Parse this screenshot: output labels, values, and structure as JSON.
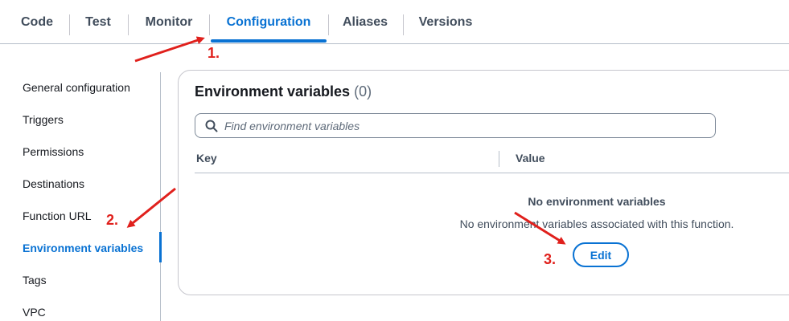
{
  "tabs": [
    {
      "label": "Code"
    },
    {
      "label": "Test"
    },
    {
      "label": "Monitor"
    },
    {
      "label": "Configuration"
    },
    {
      "label": "Aliases"
    },
    {
      "label": "Versions"
    }
  ],
  "active_tab": "Configuration",
  "sidebar": {
    "items": [
      {
        "label": "General configuration"
      },
      {
        "label": "Triggers"
      },
      {
        "label": "Permissions"
      },
      {
        "label": "Destinations"
      },
      {
        "label": "Function URL"
      },
      {
        "label": "Environment variables"
      },
      {
        "label": "Tags"
      },
      {
        "label": "VPC"
      }
    ],
    "active": "Environment variables"
  },
  "panel": {
    "title": "Environment variables",
    "count": "(0)",
    "search": {
      "placeholder": "Find environment variables",
      "value": ""
    },
    "columns": [
      "Key",
      "Value"
    ],
    "empty_title": "No environment variables",
    "empty_desc": "No environment variables associated with this function.",
    "edit_label": "Edit"
  },
  "annotations": {
    "step1": "1.",
    "step2": "2.",
    "step3": "3.",
    "color": "#e0201c"
  },
  "colors": {
    "accent": "#0972d3",
    "text": "#16191f",
    "muted": "#414d5c",
    "border": "#b6bec9"
  }
}
